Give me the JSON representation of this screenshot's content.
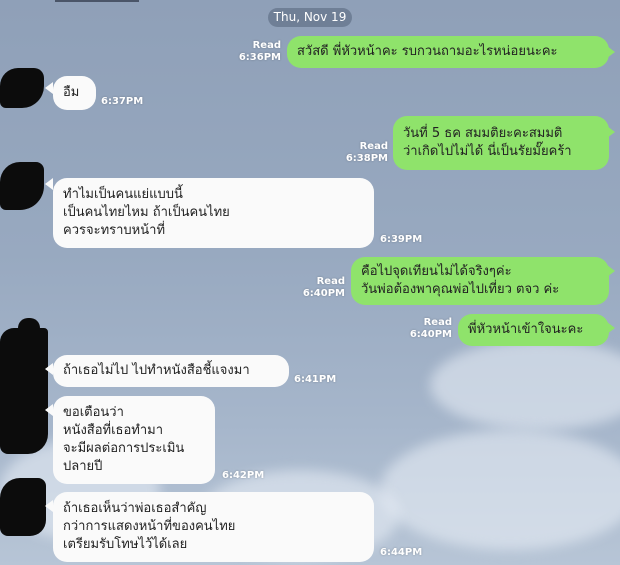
{
  "date_label": "Thu, Nov 19",
  "messages": [
    {
      "side": "out",
      "read": "Read",
      "time": "6:36PM",
      "lines": [
        "สวัสดี พี่หัวหน้าคะ รบกวนถามอะไรหน่อยนะคะ"
      ]
    },
    {
      "side": "in",
      "time": "6:37PM",
      "lines": [
        "อืม"
      ]
    },
    {
      "side": "out",
      "read": "Read",
      "time": "6:38PM",
      "lines": [
        "วันที่ 5 ธค สมมติยะคะสมมติ",
        "ว่าเกิดไปไม่ได้ นี่เป็นรัยมั๊ยคร้า"
      ]
    },
    {
      "side": "in",
      "time": "6:39PM",
      "lines": [
        "ทำไมเป็นคนแย่แบบนี้",
        "เป็นคนไทยไหม ถ้าเป็นคนไทย",
        "ควรจะทราบหน้าที่"
      ]
    },
    {
      "side": "out",
      "read": "Read",
      "time": "6:40PM",
      "lines": [
        "คือไปจุดเทียนไม่ได้จริงๆค่ะ",
        "วันพ่อต้องพาคุณพ่อไปเที่ยว ตจว ค่ะ"
      ]
    },
    {
      "side": "out",
      "read": "Read",
      "time": "6:40PM",
      "lines": [
        "พี่หัวหน้าเข้าใจนะคะ"
      ]
    },
    {
      "side": "in",
      "time": "6:41PM",
      "lines": [
        "ถ้าเธอไม่ไป ไปทำหนังสือชี้แจงมา"
      ]
    },
    {
      "side": "in",
      "time": "6:42PM",
      "lines": [
        "ขอเตือนว่า",
        "หนังสือที่เธอทำมา",
        "จะมีผลต่อการประเมิน",
        "ปลายปี"
      ]
    },
    {
      "side": "in",
      "time": "6:44PM",
      "lines": [
        "ถ้าเธอเห็นว่าพ่อเธอสำคัญ",
        "กว่าการแสดงหน้าที่ของคนไทย",
        "เตรียมรับโทษไว้ได้เลย"
      ]
    }
  ]
}
